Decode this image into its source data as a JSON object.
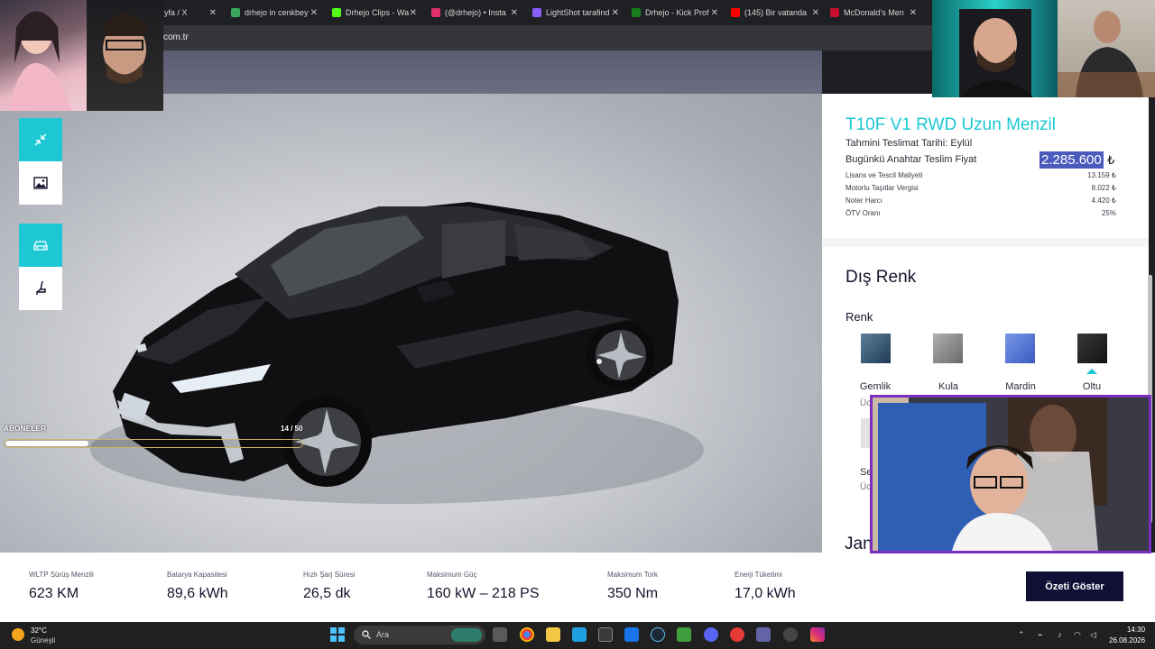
{
  "browser": {
    "tabs": [
      {
        "label": "yfa / X",
        "color": "#000000"
      },
      {
        "label": "drhejo in cenkbey",
        "color": "#3ba55d"
      },
      {
        "label": "Drhejo Clips - Wa",
        "color": "#53fc18"
      },
      {
        "label": "(@drhejo) • Insta",
        "color": "#e1306c"
      },
      {
        "label": "LightShot tarafind",
        "color": "#8a5cf6"
      },
      {
        "label": "Drhejo - Kick Prof",
        "color": "#1a7f1a"
      },
      {
        "label": "(145) Bir vatanda",
        "color": "#ff0000"
      },
      {
        "label": "McDonald's Men",
        "color": "#c8102e"
      }
    ],
    "address": "com.tr"
  },
  "viewer": {
    "tools": [
      {
        "name": "collapse-view-icon"
      },
      {
        "name": "gallery-image-icon"
      },
      {
        "name": "exterior-car-icon"
      },
      {
        "name": "interior-seat-icon"
      }
    ]
  },
  "overlay": {
    "subscribers_label": "ABONELER",
    "subscribers_count": "14 / 50",
    "subscribers_fraction": 0.28
  },
  "panel": {
    "model_title": "T10F V1 RWD Uzun Menzil",
    "delivery": "Tahmini Teslimat Tarihi: Eylül",
    "price_label": "Bugünkü Anahtar Teslim Fiyat",
    "price_value": "2.285.600",
    "currency": "₺",
    "fees": [
      {
        "label": "Lisans ve Tescil Maliyeti",
        "value": "13.159 ₺"
      },
      {
        "label": "Motorlu Taşıtlar Vergisi",
        "value": "8.022 ₺"
      },
      {
        "label": "Noter Harcı",
        "value": "4.420 ₺"
      },
      {
        "label": "ÖTV Oranı",
        "value": "25%"
      }
    ],
    "section_title": "Dış Renk",
    "color_heading": "Renk",
    "colors": [
      {
        "label": "Gemlik",
        "color": "#2e4f6a"
      },
      {
        "label": "Kula",
        "color": "#8a8a8a"
      },
      {
        "label": "Mardin",
        "color": "#4c6fd1"
      },
      {
        "label": "Oltu",
        "color": "#1c1c1c"
      }
    ],
    "partial_texts": [
      "Üc",
      "Se",
      "Üc"
    ],
    "section_title_2": "Jan",
    "accent": "#1dc8d4"
  },
  "specs": [
    {
      "label": "WLTP Sürüş Menzili",
      "value": "623 KM"
    },
    {
      "label": "Batarya Kapasitesi",
      "value": "89,6 kWh"
    },
    {
      "label": "Hızlı Şarj Süresi",
      "value": "26,5 dk"
    },
    {
      "label": "Maksimum Güç",
      "value": "160 kW – 218 PS"
    },
    {
      "label": "Maksimum Tork",
      "value": "350 Nm"
    },
    {
      "label": "Enerji Tüketimi",
      "value": "17,0 kWh"
    }
  ],
  "summary_button": "Özeti Göster",
  "taskbar": {
    "temperature": "32°C",
    "weather": "Güneşli",
    "search_placeholder": "Ara",
    "time": "14:30",
    "date": "26.08.2026"
  }
}
